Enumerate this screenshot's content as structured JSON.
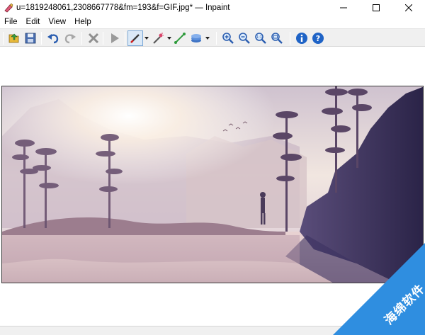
{
  "window": {
    "title": "u=1819248061,2308667778&fm=193&f=GIF.jpg* — Inpaint"
  },
  "menu": {
    "file": "File",
    "edit": "Edit",
    "view": "View",
    "help": "Help"
  },
  "toolbar": {
    "icons": [
      "open-icon",
      "save-icon",
      "undo-icon",
      "redo-icon",
      "clear-icon",
      "run-icon",
      "marker-icon",
      "magic-wand-icon",
      "line-icon",
      "layers-icon",
      "zoom-in-icon",
      "zoom-out-icon",
      "zoom-actual-icon",
      "zoom-fit-icon",
      "info-icon",
      "help-icon"
    ]
  },
  "watermark": {
    "text": "海绵软件"
  },
  "colors": {
    "accent": "#2f8ee0",
    "toolbar_bg": "#f0f0f0"
  }
}
